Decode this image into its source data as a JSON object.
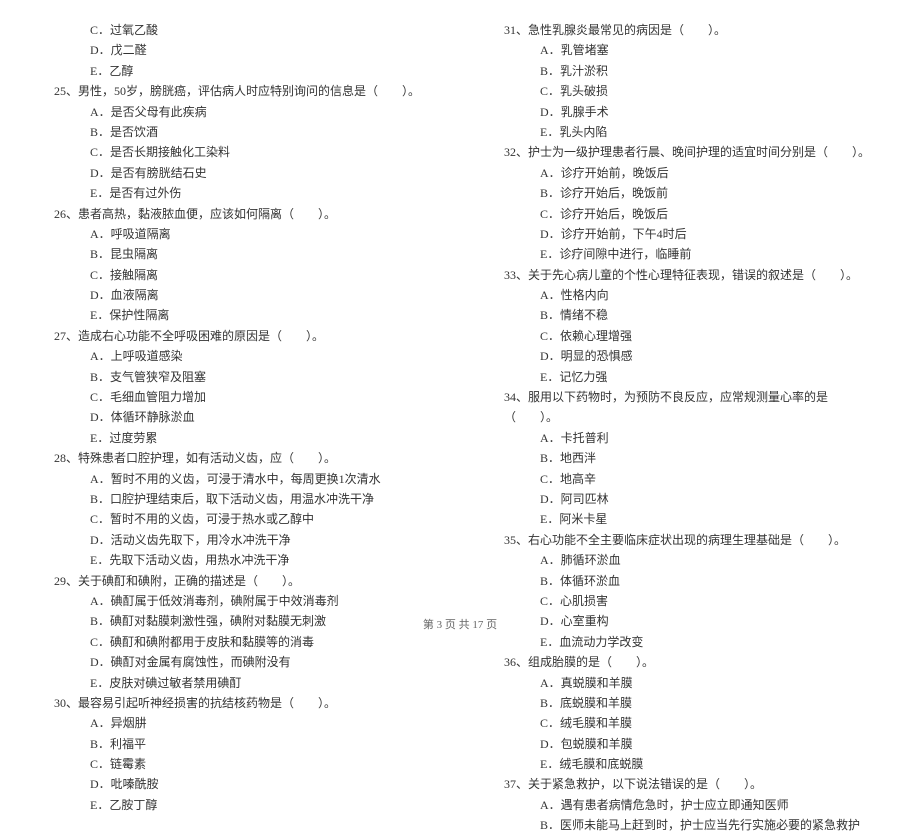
{
  "left": {
    "pre_options": [
      "C．过氧乙酸",
      "D．戊二醛",
      "E．乙醇"
    ],
    "q25": {
      "text": "25、男性，50岁，膀胱癌，评估病人时应特别询问的信息是（　　）。",
      "options": [
        "A．是否父母有此疾病",
        "B．是否饮酒",
        "C．是否长期接触化工染料",
        "D．是否有膀胱结石史",
        "E．是否有过外伤"
      ]
    },
    "q26": {
      "text": "26、患者高热，黏液脓血便，应该如何隔离（　　）。",
      "options": [
        "A．呼吸道隔离",
        "B．昆虫隔离",
        "C．接触隔离",
        "D．血液隔离",
        "E．保护性隔离"
      ]
    },
    "q27": {
      "text": "27、造成右心功能不全呼吸困难的原因是（　　）。",
      "options": [
        "A．上呼吸道感染",
        "B．支气管狭窄及阻塞",
        "C．毛细血管阻力增加",
        "D．体循环静脉淤血",
        "E．过度劳累"
      ]
    },
    "q28": {
      "text": "28、特殊患者口腔护理，如有活动义齿，应（　　）。",
      "options": [
        "A．暂时不用的义齿，可浸于清水中，每周更换1次清水",
        "B．口腔护理结束后，取下活动义齿，用温水冲洗干净",
        "C．暂时不用的义齿，可浸于热水或乙醇中",
        "D．活动义齿先取下，用冷水冲洗干净",
        "E．先取下活动义齿，用热水冲洗干净"
      ]
    },
    "q29": {
      "text": "29、关于碘酊和碘附，正确的描述是（　　）。",
      "options": [
        "A．碘酊属于低效消毒剂，碘附属于中效消毒剂",
        "B．碘酊对黏膜刺激性强，碘附对黏膜无刺激",
        "C．碘酊和碘附都用于皮肤和黏膜等的消毒",
        "D．碘酊对金属有腐蚀性，而碘附没有",
        "E．皮肤对碘过敏者禁用碘酊"
      ]
    },
    "q30": {
      "text": "30、最容易引起听神经损害的抗结核药物是（　　）。",
      "options": [
        "A．异烟肼",
        "B．利福平",
        "C．链霉素",
        "D．吡嗪酰胺",
        "E．乙胺丁醇"
      ]
    }
  },
  "right": {
    "q31": {
      "text": "31、急性乳腺炎最常见的病因是（　　）。",
      "options": [
        "A．乳管堵塞",
        "B．乳汁淤积",
        "C．乳头破损",
        "D．乳腺手术",
        "E．乳头内陷"
      ]
    },
    "q32": {
      "text": "32、护士为一级护理患者行晨、晚间护理的适宜时间分别是（　　）。",
      "options": [
        "A．诊疗开始前，晚饭后",
        "B．诊疗开始后，晚饭前",
        "C．诊疗开始后，晚饭后",
        "D．诊疗开始前，下午4时后",
        "E．诊疗间隙中进行，临睡前"
      ]
    },
    "q33": {
      "text": "33、关于先心病儿童的个性心理特征表现，错误的叙述是（　　）。",
      "options": [
        "A．性格内向",
        "B．情绪不稳",
        "C．依赖心理增强",
        "D．明显的恐惧感",
        "E．记忆力强"
      ]
    },
    "q34": {
      "text": "34、服用以下药物时，为预防不良反应，应常规测量心率的是（　　）。",
      "options": [
        "A．卡托普利",
        "B．地西泮",
        "C．地高辛",
        "D．阿司匹林",
        "E．阿米卡星"
      ]
    },
    "q35": {
      "text": "35、右心功能不全主要临床症状出现的病理生理基础是（　　）。",
      "options": [
        "A．肺循环淤血",
        "B．体循环淤血",
        "C．心肌损害",
        "D．心室重构",
        "E．血流动力学改变"
      ]
    },
    "q36": {
      "text": "36、组成胎膜的是（　　）。",
      "options": [
        "A．真蜕膜和羊膜",
        "B．底蜕膜和羊膜",
        "C．绒毛膜和羊膜",
        "D．包蜕膜和羊膜",
        "E．绒毛膜和底蜕膜"
      ]
    },
    "q37": {
      "text": "37、关于紧急救护，以下说法错误的是（　　）。",
      "options": [
        "A．遇有患者病情危急时，护士应立即通知医师",
        "B．医师未能马上赶到时，护士应当先行实施必要的紧急救护"
      ]
    }
  },
  "footer": "第 3 页  共 17 页"
}
